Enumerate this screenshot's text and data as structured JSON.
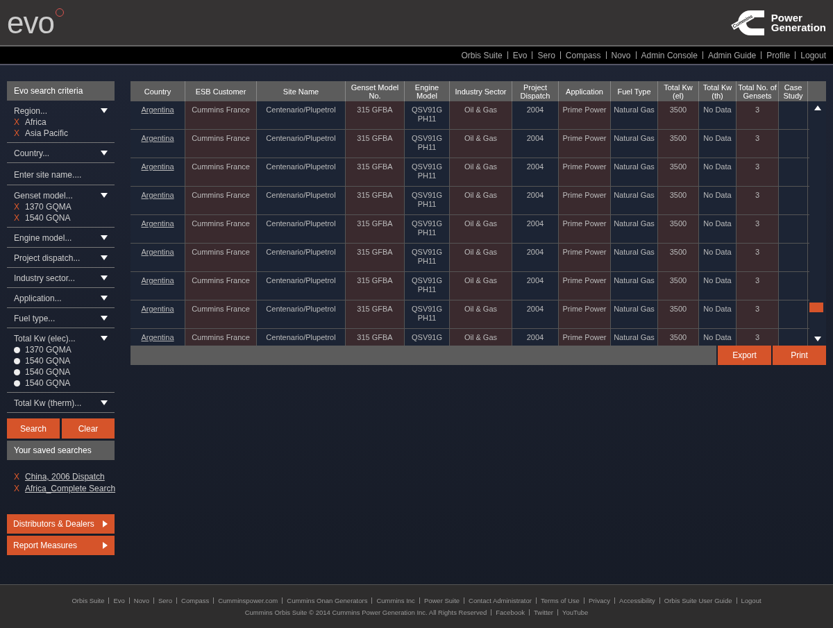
{
  "header": {
    "logo": "evo",
    "brand_mark": "Cummins",
    "brand": [
      "Power",
      "Generation"
    ]
  },
  "top_nav": [
    "Orbis Suite",
    "Evo",
    "Sero",
    "Compass",
    "Novo",
    "Admin Console",
    "Admin Guide",
    "Profile",
    "Logout"
  ],
  "sidebar": {
    "title": "Evo search criteria",
    "filters": [
      {
        "kind": "dropdown",
        "label": "Region...",
        "chips": [
          {
            "remove": "X",
            "label": "Africa"
          },
          {
            "remove": "X",
            "label": "Asia Pacific"
          }
        ]
      },
      {
        "kind": "dropdown",
        "label": "Country..."
      },
      {
        "kind": "text",
        "placeholder": "Enter site name...."
      },
      {
        "kind": "dropdown",
        "label": "Genset model...",
        "chips": [
          {
            "remove": "X",
            "label": "1370 GQMA"
          },
          {
            "remove": "X",
            "label": "1540 GQNA"
          }
        ]
      },
      {
        "kind": "dropdown",
        "label": "Engine model..."
      },
      {
        "kind": "dropdown",
        "label": "Project dispatch..."
      },
      {
        "kind": "dropdown",
        "label": "Industry sector..."
      },
      {
        "kind": "dropdown",
        "label": "Application..."
      },
      {
        "kind": "dropdown",
        "label": "Fuel type..."
      },
      {
        "kind": "dropdown",
        "label": "Total Kw (elec)...",
        "options": [
          {
            "label": "1370 GQMA",
            "selected": false
          },
          {
            "label": "1540 GQNA",
            "selected": false
          },
          {
            "label": "1540 GQNA",
            "selected": false
          },
          {
            "label": "1540 GQNA",
            "selected": false
          }
        ]
      },
      {
        "kind": "dropdown",
        "label": "Total Kw (therm)..."
      }
    ],
    "buttons": [
      "Search",
      "Clear"
    ],
    "saved_title": "Your saved searches",
    "saved": [
      {
        "remove": "X",
        "label": "China, 2006 Dispatch"
      },
      {
        "remove": "X",
        "label": "Africa_Complete Search"
      }
    ],
    "links": [
      "Distributors & Dealers",
      "Report Measures"
    ]
  },
  "table": {
    "columns": [
      "Country",
      "ESB Customer",
      "Site Name",
      "Genset Model No.",
      "Engine Model",
      "Industry Sector",
      "Project Dispatch",
      "Application",
      "Fuel Type",
      "Total Kw (el)",
      "Total Kw (th)",
      "Total No. of Gensets",
      "Case Study"
    ],
    "rows": [
      [
        "Argentina",
        "Cummins France",
        "Centenario/Plupetrol",
        "315 GFBA",
        "QSV91G PH11",
        "Oil & Gas",
        "2004",
        "Prime Power",
        "Natural Gas",
        "3500",
        "No Data",
        "3",
        ""
      ],
      [
        "Argentina",
        "Cummins France",
        "Centenario/Plupetrol",
        "315 GFBA",
        "QSV91G PH11",
        "Oil & Gas",
        "2004",
        "Prime Power",
        "Natural Gas",
        "3500",
        "No Data",
        "3",
        ""
      ],
      [
        "Argentina",
        "Cummins France",
        "Centenario/Plupetrol",
        "315 GFBA",
        "QSV91G PH11",
        "Oil & Gas",
        "2004",
        "Prime Power",
        "Natural Gas",
        "3500",
        "No Data",
        "3",
        ""
      ],
      [
        "Argentina",
        "Cummins France",
        "Centenario/Plupetrol",
        "315 GFBA",
        "QSV91G PH11",
        "Oil & Gas",
        "2004",
        "Prime Power",
        "Natural Gas",
        "3500",
        "No Data",
        "3",
        ""
      ],
      [
        "Argentina",
        "Cummins France",
        "Centenario/Plupetrol",
        "315 GFBA",
        "QSV91G PH11",
        "Oil & Gas",
        "2004",
        "Prime Power",
        "Natural Gas",
        "3500",
        "No Data",
        "3",
        ""
      ],
      [
        "Argentina",
        "Cummins France",
        "Centenario/Plupetrol",
        "315 GFBA",
        "QSV91G PH11",
        "Oil & Gas",
        "2004",
        "Prime Power",
        "Natural Gas",
        "3500",
        "No Data",
        "3",
        ""
      ],
      [
        "Argentina",
        "Cummins France",
        "Centenario/Plupetrol",
        "315 GFBA",
        "QSV91G PH11",
        "Oil & Gas",
        "2004",
        "Prime Power",
        "Natural Gas",
        "3500",
        "No Data",
        "3",
        ""
      ],
      [
        "Argentina",
        "Cummins France",
        "Centenario/Plupetrol",
        "315 GFBA",
        "QSV91G PH11",
        "Oil & Gas",
        "2004",
        "Prime Power",
        "Natural Gas",
        "3500",
        "No Data",
        "3",
        ""
      ],
      [
        "Argentina",
        "Cummins France",
        "Centenario/Plupetrol",
        "315 GFBA",
        "QSV91G",
        "Oil & Gas",
        "2004",
        "Prime Power",
        "Natural Gas",
        "3500",
        "No Data",
        "3",
        ""
      ]
    ],
    "actions": [
      "Export",
      "Print"
    ]
  },
  "footer": {
    "links": [
      "Orbis Suite",
      "Evo",
      "Novo",
      "Sero",
      "Compass",
      "Cumminspower.com",
      "Cummins Onan Generators",
      "Cummins Inc",
      "Power Suite",
      "Contact Administrator",
      "Terms of Use",
      "Privacy",
      "Accessibility",
      "Orbis Suite User Guide",
      "Logout"
    ],
    "copyright": "Cummins Orbis Suite © 2014 Cummins Power Generation Inc. All Rights Reserved",
    "social": [
      "Facebook",
      "Twitter",
      "YouTube"
    ]
  }
}
